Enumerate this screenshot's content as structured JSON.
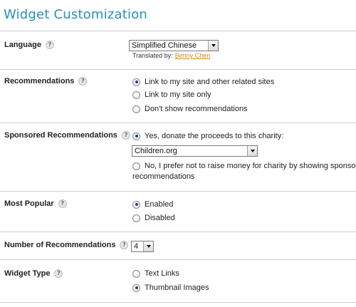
{
  "page_title": "Widget Customization",
  "language": {
    "label": "Language",
    "selected": "Simplified Chinese",
    "translated_by_label": "Translated by:",
    "translator": "Benny Chen"
  },
  "recommendations": {
    "label": "Recommendations",
    "options": [
      "Link to my site and other related sites",
      "Link to my site only",
      "Don't show recommendations"
    ],
    "selected_index": 0
  },
  "sponsored": {
    "label": "Sponsored Recommendations",
    "yes_label": "Yes, donate the proceeds to this charity:",
    "charity_selected": "Children.org",
    "no_label_line1": "No, I prefer not to raise money for charity by showing sponsored",
    "no_label_line2": "recommendations",
    "selected": "yes"
  },
  "most_popular": {
    "label": "Most Popular",
    "options": [
      "Enabled",
      "Disabled"
    ],
    "selected_index": 0
  },
  "number_of_recommendations": {
    "label": "Number of Recommendations",
    "selected": "4"
  },
  "widget_type": {
    "label": "Widget Type",
    "options": [
      "Text Links",
      "Thumbnail Images"
    ],
    "selected_index": 1
  },
  "help_glyph": "?",
  "colors": {
    "title": "#2a8fbd",
    "link": "#d08a14",
    "divider": "#cfcfcf",
    "radio_dot": "#1e3f7a"
  }
}
